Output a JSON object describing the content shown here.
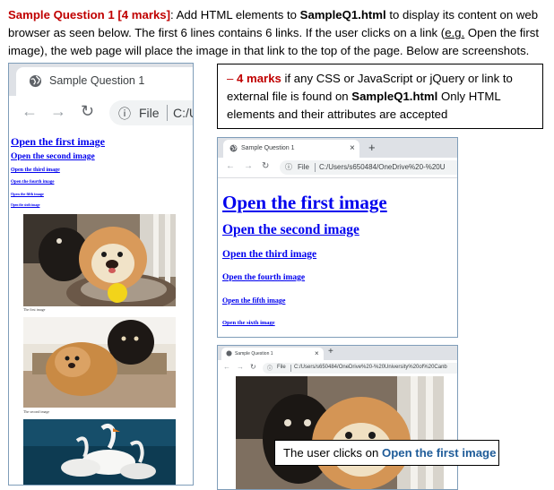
{
  "intro": {
    "label": "Sample Question 1 [4 marks]",
    "t1": ": Add HTML elements to ",
    "file": "SampleQ1.html",
    "t2": " to display its content on web browser as seen below. The first 6 lines contains 6 links. If the user clicks on a link (",
    "eg": "e.g.",
    "t3": " Open the first image), the web page will place the image in that link to the top of the page. Below are screenshots."
  },
  "note": {
    "dash": "– ",
    "marks": "4 marks",
    "t1": " if any CSS or JavaScript or jQuery or link to external file is found on ",
    "file": "SampleQ1.html",
    "t2": " Only HTML elements and their attributes are accepted"
  },
  "browser": {
    "tab_title": "Sample Question 1",
    "back": "←",
    "forward": "→",
    "reload": "↻",
    "info": "ⓘ",
    "file_label": "File",
    "path_short": "C:/U",
    "path_long": "C:/Users/s650484/OneDrive%20-%20U",
    "path_long3": "C:/Users/s650484/OneDrive%20-%20University%20of%20Canb",
    "close": "×",
    "new_tab": "+"
  },
  "links": [
    "Open the first image",
    "Open the second image",
    "Open the third image",
    "Open the fourth image",
    "Open the fifth image",
    "Open the sixth image"
  ],
  "captions": [
    "The first image",
    "The second image"
  ],
  "click_note": {
    "t1": "The user clicks on ",
    "link": "Open the first image"
  },
  "colors": {
    "link": "#0000ee",
    "accent_red": "#c00000",
    "accent_blue": "#1f5c99"
  },
  "icons": [
    "globe-icon",
    "back-arrow-icon",
    "forward-arrow-icon",
    "reload-icon",
    "info-icon",
    "close-icon",
    "plus-icon"
  ]
}
